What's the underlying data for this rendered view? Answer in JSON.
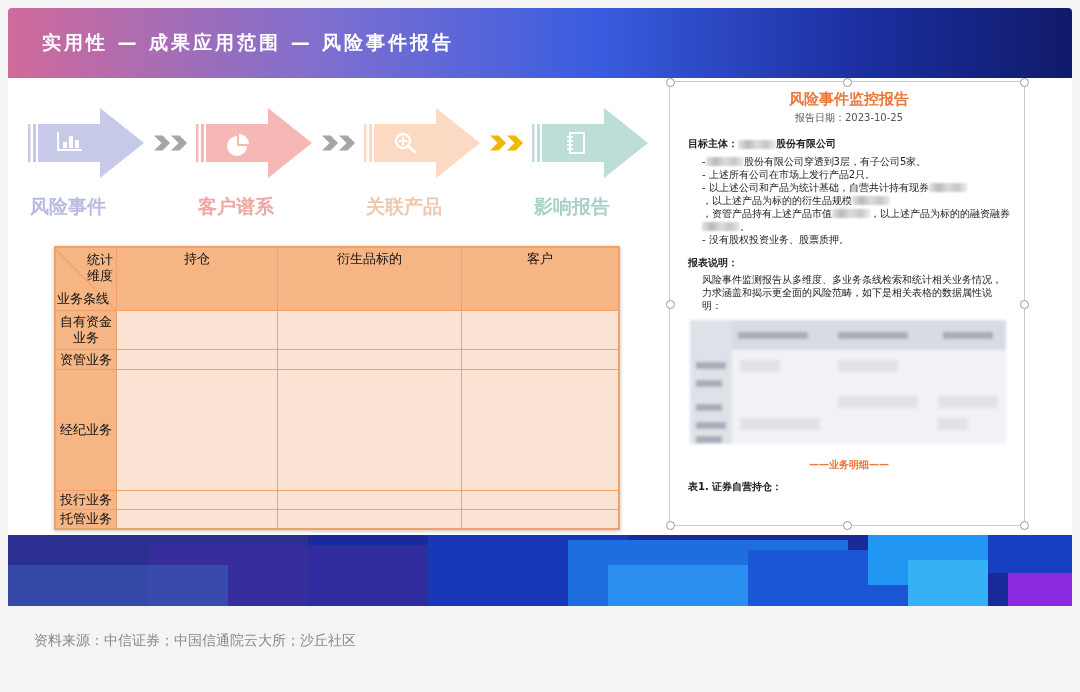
{
  "banner": {
    "title": "实用性 — 成果应用范围 — 风险事件报告"
  },
  "flow": {
    "steps": [
      {
        "label": "风险事件",
        "color": "#c7c9e9"
      },
      {
        "label": "客户谱系",
        "color": "#f5b8b4"
      },
      {
        "label": "关联产品",
        "color": "#fcd9c2"
      },
      {
        "label": "影响报告",
        "color": "#bcddd8"
      }
    ],
    "connectors": [
      {
        "color": "#a6a6a6"
      },
      {
        "color": "#a6a6a6"
      },
      {
        "color": "#f0b800"
      }
    ]
  },
  "table": {
    "corner": {
      "top": "统计维度",
      "bottom": "业务条线"
    },
    "columns": [
      "持仓",
      "衍生品标的",
      "客户"
    ],
    "rows": [
      {
        "label": "自有资金业务"
      },
      {
        "label": "资管业务"
      },
      {
        "label": "经纪业务"
      },
      {
        "label": "投行业务"
      },
      {
        "label": "托管业务"
      }
    ]
  },
  "document": {
    "title": "风险事件监控报告",
    "date": "报告日期：2023-10-25",
    "subject": [
      {
        "kind": "text",
        "text": "目标主体："
      },
      {
        "kind": "redacted"
      },
      {
        "kind": "text",
        "text": "股份有限公司"
      }
    ],
    "bullets": [
      {
        "segments": [
          {
            "kind": "text",
            "text": "- "
          },
          {
            "kind": "redacted"
          },
          {
            "kind": "text",
            "text": "股份有限公司穿透到3层，有子公司5家。"
          }
        ]
      },
      {
        "segments": [
          {
            "kind": "text",
            "text": "- 上述所有公司在市场上发行产品2只。"
          }
        ]
      },
      {
        "segments": [
          {
            "kind": "text",
            "text": "- 以上述公司和产品为统计基础，自营共计持有现券"
          },
          {
            "kind": "redacted"
          },
          {
            "kind": "text",
            "text": "，以上述产品为标的的衍生品规模"
          },
          {
            "kind": "redacted"
          },
          {
            "kind": "text",
            "text": "，资管产品持有上述产品市值"
          },
          {
            "kind": "redacted"
          },
          {
            "kind": "text",
            "text": "，以上述产品为标的的融资融券"
          },
          {
            "kind": "redacted"
          },
          {
            "kind": "text",
            "text": "。"
          }
        ]
      },
      {
        "segments": [
          {
            "kind": "text",
            "text": "- 没有股权投资业务、股票质押。"
          }
        ]
      }
    ],
    "notes_heading": "报表说明：",
    "notes": "风险事件监测报告从多维度、多业务条线检索和统计相关业务情况，力求涵盖和揭示更全面的风险范畴，如下是相关表格的数据属性说明：",
    "section": "——业务明细——",
    "table_caption": "表1. 证券自营持仓："
  },
  "caption": "资料来源：中信证券；中国信通院云大所；沙丘社区"
}
